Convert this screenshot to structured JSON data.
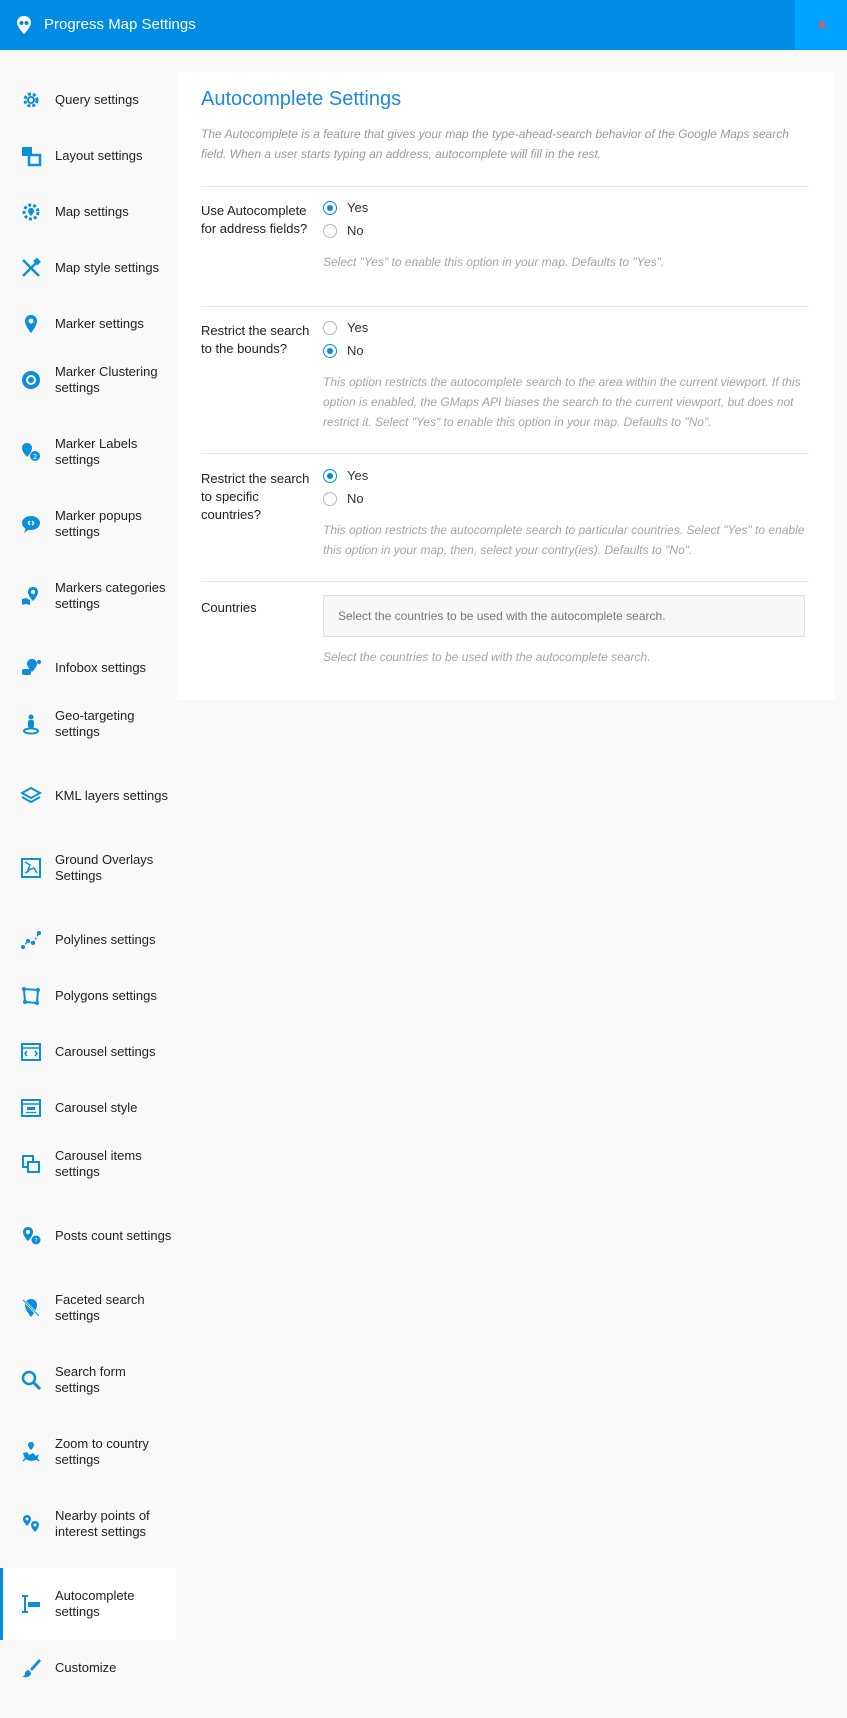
{
  "app": {
    "title": "Progress Map Settings",
    "accent_color": "#008be5",
    "close_icon": "close-icon"
  },
  "sidebar": {
    "items": [
      {
        "label": "Query settings",
        "icon": "gear-icon"
      },
      {
        "label": "Layout settings",
        "icon": "layout-icon"
      },
      {
        "label": "Map settings",
        "icon": "map-gear-icon"
      },
      {
        "label": "Map style settings",
        "icon": "style-tools-icon"
      },
      {
        "label": "Marker settings",
        "icon": "marker-icon"
      },
      {
        "label": "Marker Clustering settings",
        "icon": "cluster-icon"
      },
      {
        "label": "Marker Labels settings",
        "icon": "marker-label-icon"
      },
      {
        "label": "Marker popups settings",
        "icon": "popup-icon"
      },
      {
        "label": "Markers categories settings",
        "icon": "categories-icon"
      },
      {
        "label": "Infobox settings",
        "icon": "infobox-icon"
      },
      {
        "label": "Geo-targeting settings",
        "icon": "geo-target-icon"
      },
      {
        "label": "KML layers settings",
        "icon": "layers-icon"
      },
      {
        "label": "Ground Overlays Settings",
        "icon": "overlay-icon"
      },
      {
        "label": "Polylines settings",
        "icon": "polyline-icon"
      },
      {
        "label": "Polygons settings",
        "icon": "polygon-icon"
      },
      {
        "label": "Carousel settings",
        "icon": "carousel-icon"
      },
      {
        "label": "Carousel style",
        "icon": "carousel-style-icon"
      },
      {
        "label": "Carousel items settings",
        "icon": "carousel-items-icon"
      },
      {
        "label": "Posts count settings",
        "icon": "posts-count-icon"
      },
      {
        "label": "Faceted search settings",
        "icon": "faceted-search-icon"
      },
      {
        "label": "Search form settings",
        "icon": "search-icon"
      },
      {
        "label": "Zoom to country settings",
        "icon": "zoom-country-icon"
      },
      {
        "label": "Nearby points of interest settings",
        "icon": "nearby-poi-icon"
      },
      {
        "label": "Autocomplete settings",
        "icon": "autocomplete-icon",
        "active": true
      },
      {
        "label": "Customize",
        "icon": "brush-icon"
      }
    ]
  },
  "panel": {
    "title": "Autocomplete Settings",
    "intro": "The Autocomplete is a feature that gives your map the type-ahead-search behavior of the Google Maps search field. When a user starts typing an address, autocomplete will fill in the rest.",
    "fields": [
      {
        "label": "Use Autocomplete for address fields?",
        "options": [
          "Yes",
          "No"
        ],
        "selected": "Yes",
        "help": "Select \"Yes\" to enable this option in your map. Defaults to \"Yes\"."
      },
      {
        "label": "Restrict the search to the bounds?",
        "options": [
          "Yes",
          "No"
        ],
        "selected": "No",
        "help": "This option restricts the autocomplete search to the area within the current viewport. If this option is enabled, the GMaps API biases the search to the current viewport, but does not restrict it. Select \"Yes\" to enable this option in your map. Defaults to \"No\"."
      },
      {
        "label": "Restrict the search to specific countries?",
        "options": [
          "Yes",
          "No"
        ],
        "selected": "Yes",
        "help": "This option restricts the autocomplete search to particular countries. Select \"Yes\" to enable this option in your map, then, select your contry(ies). Defaults to \"No\"."
      }
    ],
    "countries": {
      "label": "Countries",
      "placeholder": "Select the countries to be used with the autocomplete search.",
      "help": "Select the countries to be used with the autocomplete search."
    }
  }
}
